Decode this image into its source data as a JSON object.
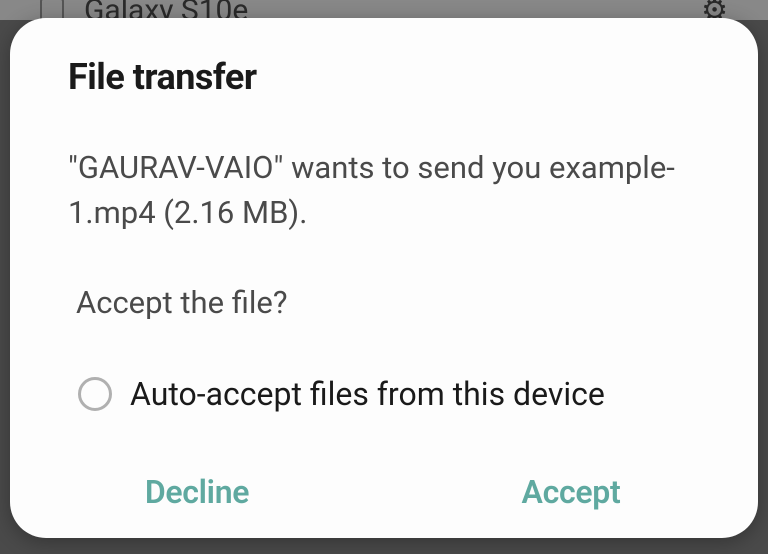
{
  "background": {
    "device_name": "Galaxy S10e"
  },
  "dialog": {
    "title": "File transfer",
    "message": "\"GAURAV-VAIO\" wants to send you example-1.mp4 (2.16 MB).",
    "confirm_question": "Accept the file?",
    "auto_accept_label": "Auto-accept files from this device",
    "decline_label": "Decline",
    "accept_label": "Accept"
  }
}
